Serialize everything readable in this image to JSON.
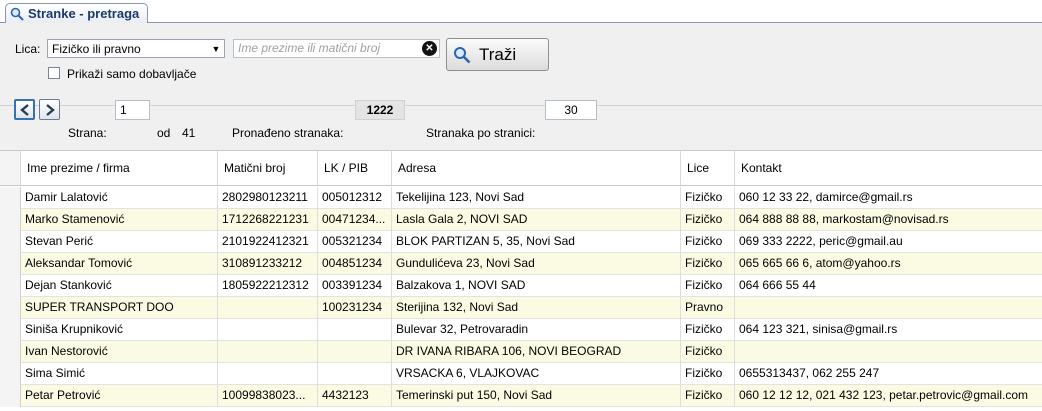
{
  "tab": {
    "title": "Stranke - pretraga"
  },
  "filters": {
    "lica_label": "Lica:",
    "lica_value": "Fizičko ili pravno",
    "search_placeholder": "Ime prezime ili matični broj",
    "search_value": "",
    "search_button": "Traži",
    "suppliers_label": "Prikaži samo dobavljače",
    "suppliers_checked": false
  },
  "pager": {
    "page_label": "Strana:",
    "page_value": "1",
    "of_label": "od",
    "total_pages": "41",
    "found_label": "Pronađeno stranaka:",
    "found_count": "1222",
    "per_page_label": "Stranaka po stranici:",
    "per_page_value": "30"
  },
  "table": {
    "columns": [
      "Ime prezime / firma",
      "Matični broj",
      "LK / PIB",
      "Adresa",
      "Lice",
      "Kontakt"
    ],
    "rows": [
      [
        "Damir Lalatović",
        "2802980123211",
        "005012312",
        "Tekelijina 123, Novi Sad",
        "Fizičko",
        "060 12 33 22, damirce@gmail.rs"
      ],
      [
        "Marko Stamenović",
        "1712268221231",
        "00471234...",
        "Lasla Gala 2, NOVI SAD",
        "Fizičko",
        "064 888 88 88, markostam@novisad.rs"
      ],
      [
        "Stevan Perić",
        "2101922412321",
        "005321234",
        "BLOK PARTIZAN 5, 35, Novi Sad",
        "Fizičko",
        "069 333 2222, peric@gmail.au"
      ],
      [
        "Aleksandar Tomović",
        "310891233212",
        "004851234",
        "Gundulićeva 23, Novi Sad",
        "Fizičko",
        "065 665 66 6, atom@yahoo.rs"
      ],
      [
        "Dejan Stanković",
        "1805922212312",
        "003391234",
        "Balzakova 1, NOVI SAD",
        "Fizičko",
        "064 666 55 44"
      ],
      [
        "SUPER TRANSPORT DOO",
        "",
        "100231234",
        "Sterijina 132, Novi Sad",
        "Pravno",
        ""
      ],
      [
        "Siniša Krupniković",
        "",
        "",
        "Bulevar 32, Petrovaradin",
        "Fizičko",
        "064 123 321, sinisa@gmail.rs"
      ],
      [
        "Ivan Nestorović",
        "",
        "",
        "DR IVANA RIBARA 106, NOVI  BEOGRAD",
        "Fizičko",
        ""
      ],
      [
        "Sima Simić",
        "",
        "",
        "VRSACKA 6, VLAJKOVAC",
        "Fizičko",
        "0655313437, 062 255 247"
      ],
      [
        "Petar Petrović",
        "10099838023...",
        "4432123",
        "Temerinski put 150, Novi Sad",
        "Fizičko",
        "060 12 12 12, 021 432 123, petar.petrovic@gmail.com"
      ]
    ]
  }
}
